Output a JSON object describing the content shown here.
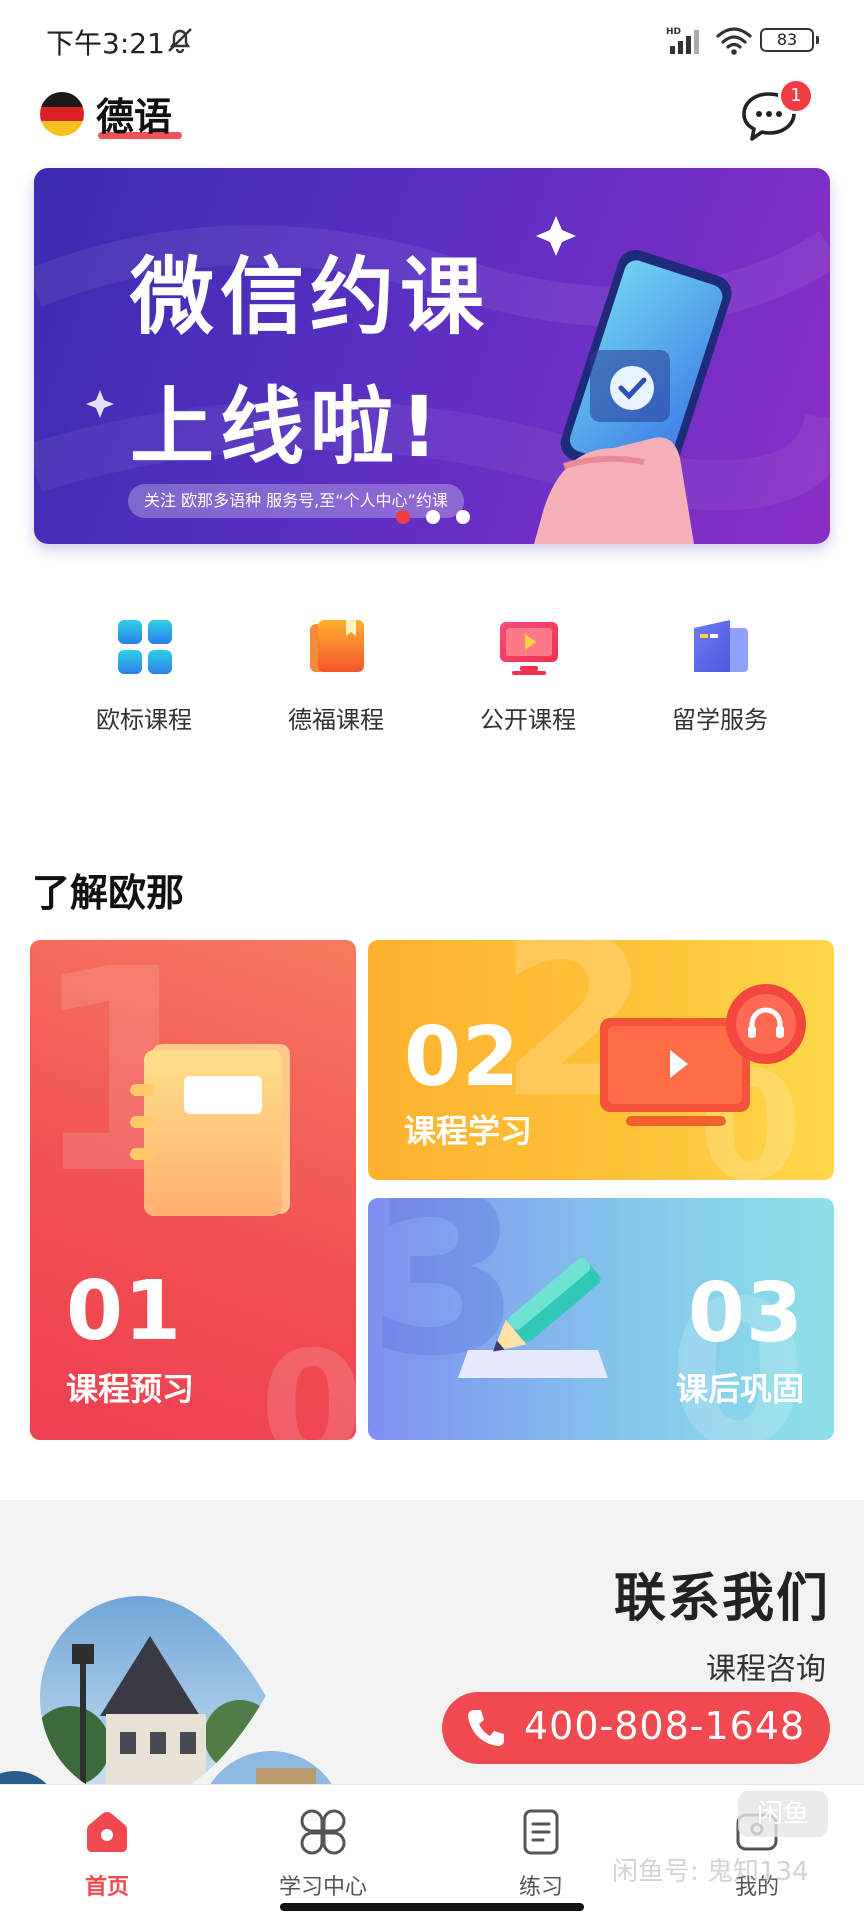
{
  "status_bar": {
    "time": "下午3:21",
    "battery": "83"
  },
  "header": {
    "title": "德语",
    "message_badge": "1"
  },
  "banner": {
    "title_line1": "微信约课",
    "title_line2": "上线啦!",
    "caption": "关注 欧那多语种 服务号,至“个人中心”约课",
    "page_count": 3,
    "active_page": 1
  },
  "quick_menu": [
    {
      "label": "欧标课程",
      "icon": "grid-apps-icon"
    },
    {
      "label": "德福课程",
      "icon": "book-icon"
    },
    {
      "label": "公开课程",
      "icon": "tv-play-icon"
    },
    {
      "label": "留学服务",
      "icon": "documents-icon"
    }
  ],
  "section": {
    "title": "了解欧那",
    "cards": [
      {
        "number": "01",
        "label": "课程预习",
        "bg_digit": "1"
      },
      {
        "number": "02",
        "label": "课程学习",
        "bg_digit": "2"
      },
      {
        "number": "03",
        "label": "课后巩固",
        "bg_digit": "3"
      }
    ]
  },
  "contact": {
    "title": "联系我们",
    "subtitle": "课程咨询",
    "phone": "400-808-1648"
  },
  "tab_bar": {
    "items": [
      {
        "label": "首页",
        "active": true
      },
      {
        "label": "学习中心",
        "active": false
      },
      {
        "label": "练习",
        "active": false
      },
      {
        "label": "我的",
        "active": false
      }
    ],
    "watermark": "闲鱼号: 鬼知134",
    "watermark_logo": "闲鱼"
  },
  "colors": {
    "accent": "#f04a50",
    "banner_start": "#3b2cb0",
    "banner_end": "#8a2fc6"
  }
}
